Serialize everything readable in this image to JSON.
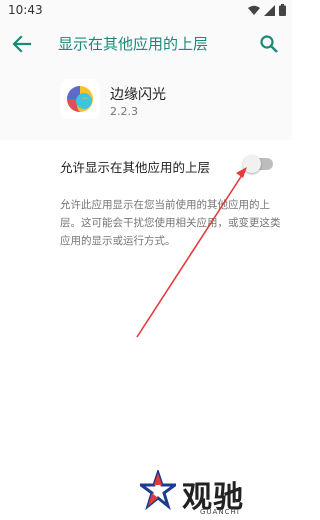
{
  "status_bar": {
    "time": "10:43"
  },
  "header": {
    "title": "显示在其他应用的上层"
  },
  "app": {
    "name": "边缘闪光",
    "version": "2.2.3"
  },
  "setting": {
    "label": "允许显示在其他应用的上层",
    "enabled": false
  },
  "description": "允许此应用显示在您当前使用的其他应用的上层。这可能会干扰您使用相关应用，或变更这类应用的显示或运行方式。",
  "watermark": {
    "brand": "观驰",
    "sub": "GUANCHI"
  },
  "colors": {
    "accent": "#1a8a78",
    "arrow": "#e23b3b"
  }
}
